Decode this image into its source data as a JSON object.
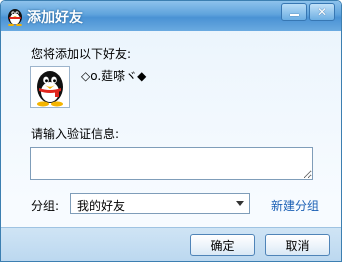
{
  "window": {
    "title": "添加好友",
    "minimize_icon": "minimize-icon",
    "close_icon": "close-icon",
    "close_glyph": "✕"
  },
  "form": {
    "prompt": "您将添加以下好友:",
    "friend_name": "◇o.莚嗏ヾ◆",
    "avatar_icon": "qq-penguin-icon",
    "verify_label": "请输入验证信息:",
    "verify_value": "",
    "group_label": "分组:",
    "group_selected": "我的好友",
    "new_group_link": "新建分组"
  },
  "buttons": {
    "ok": "确定",
    "cancel": "取消"
  },
  "colors": {
    "title_bar": "#5fa3dc",
    "link": "#1a5fb4",
    "border": "#7f9db9"
  }
}
